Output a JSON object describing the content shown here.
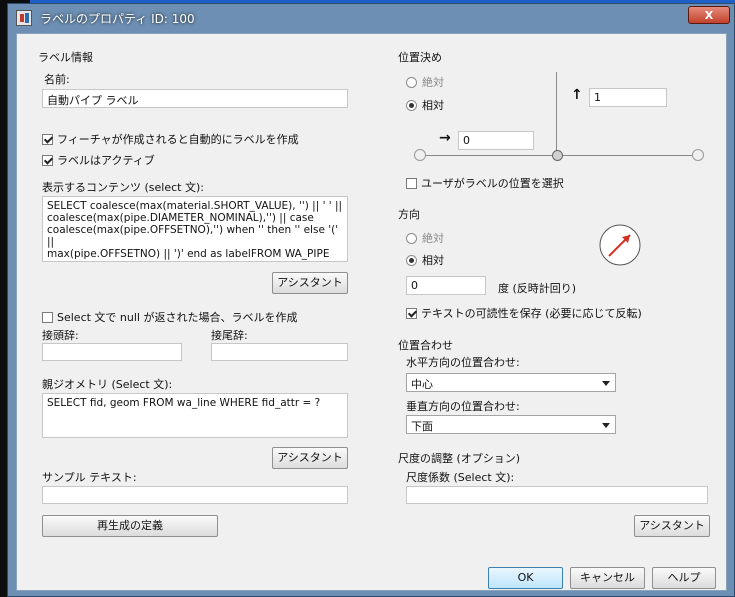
{
  "window": {
    "title": "ラベルのプロパティ ID: 100",
    "close": "X"
  },
  "label_info": {
    "section": "ラベル情報",
    "name_label": "名前:",
    "name_value": "自動パイプ ラベル",
    "auto_create": "フィーチャが作成されると自動的にラベルを作成",
    "active": "ラベルはアクティブ",
    "content_label": "表示するコンテンツ (select 文):",
    "content_value": "SELECT coalesce(max(material.SHORT_VALUE), '') || ' ' ||\ncoalesce(max(pipe.DIAMETER_NOMINAL),'') || case\ncoalesce(max(pipe.OFFSETNO),'') when '' then '' else '(' ||\nmax(pipe.OFFSETNO) || ')' end as labelFROM WA_PIPE\npipe LEFT OUTER JOIN WA_LINE line ON pipe.FID =",
    "assistant1": "アシスタント",
    "null_check": "Select 文で null が返された場合、ラベルを作成",
    "prefix": "接頭辞:",
    "suffix": "接尾辞:",
    "parent_label": "親ジオメトリ (Select 文):",
    "parent_value": "SELECT fid, geom FROM wa_line WHERE fid_attr = ?",
    "assistant2": "アシスタント",
    "sample_label": "サンプル テキスト:",
    "regen": "再生成の定義"
  },
  "positioning": {
    "section": "位置決め",
    "absolute": "絶対",
    "relative": "相対",
    "offset_x": "0",
    "offset_y": "1",
    "user_select": "ユーザがラベルの位置を選択"
  },
  "direction": {
    "section": "方向",
    "absolute": "絶対",
    "relative": "相対",
    "angle": "0",
    "angle_unit": "度 (反時計回り)",
    "keep_readable": "テキストの可読性を保存 (必要に応じて反転)"
  },
  "alignment": {
    "section": "位置合わせ",
    "h_label": "水平方向の位置合わせ:",
    "h_value": "中心",
    "v_label": "垂直方向の位置合わせ:",
    "v_value": "下面"
  },
  "scale": {
    "section": "尺度の調整 (オプション)",
    "factor_label": "尺度係数 (Select 文):",
    "assistant3": "アシスタント"
  },
  "footer": {
    "ok": "OK",
    "cancel": "キャンセル",
    "help": "ヘルプ"
  },
  "colors": {
    "arrow": "#d43020",
    "title_bar": "#6d8fb3"
  }
}
